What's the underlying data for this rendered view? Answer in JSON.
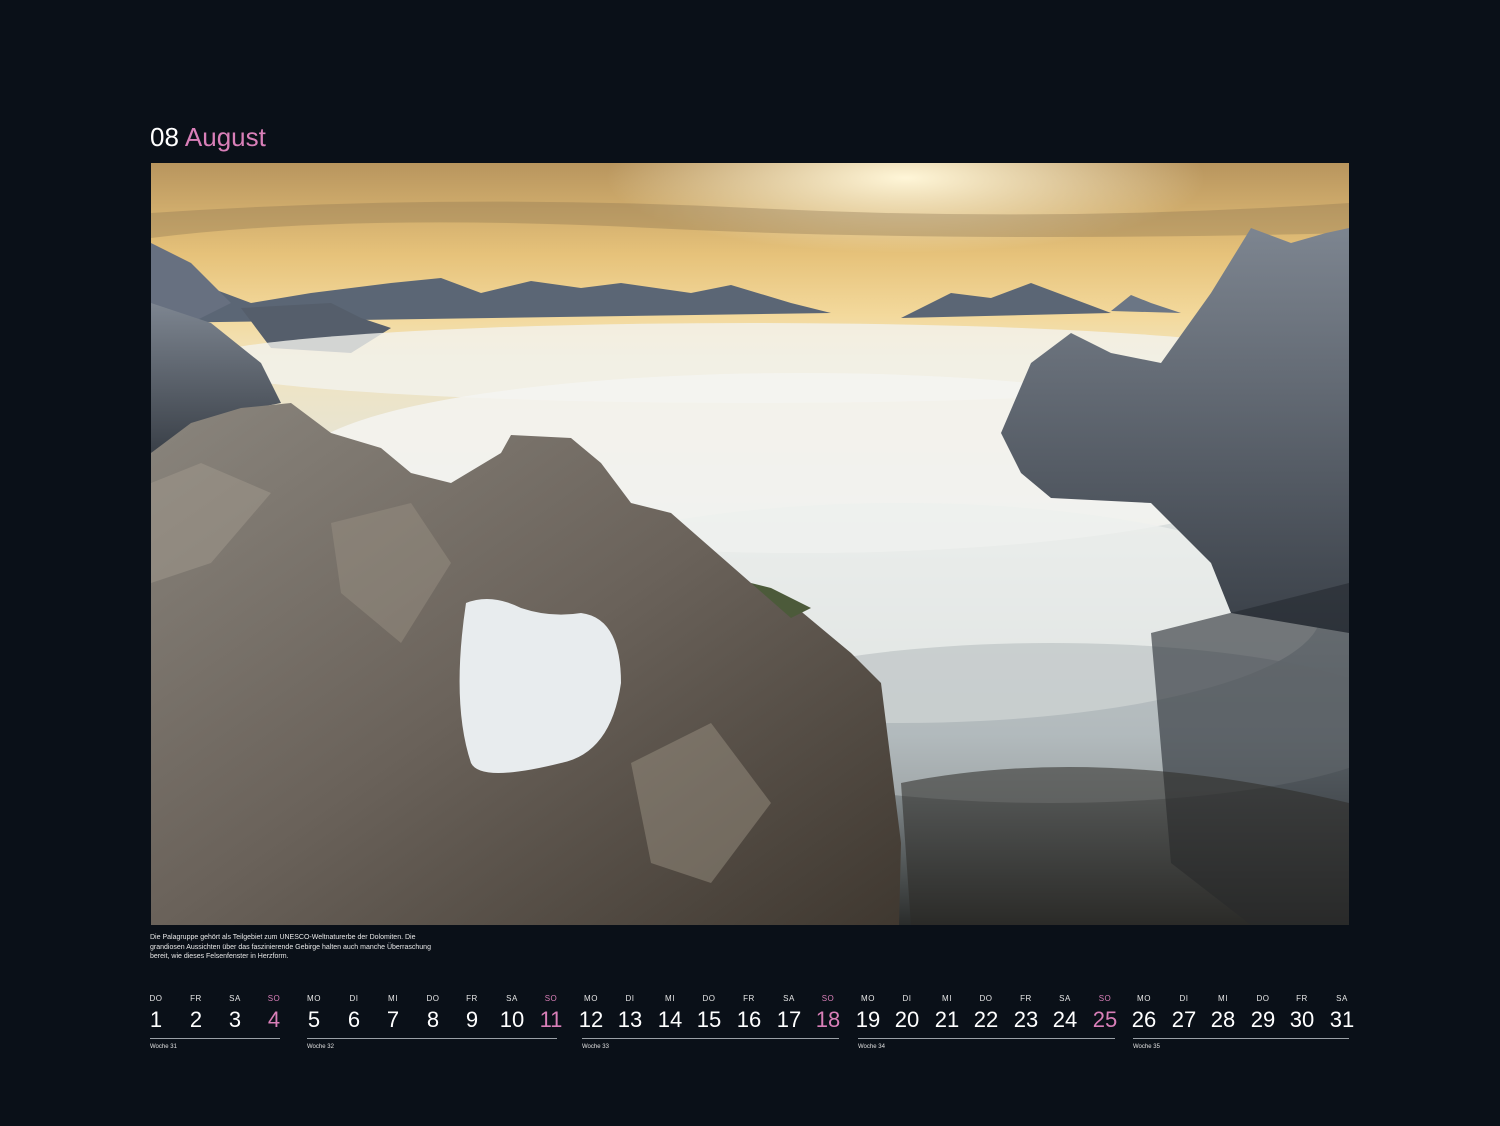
{
  "header": {
    "month_number": "08",
    "month_name": "August"
  },
  "caption": "Die Palagruppe gehört als Teilgebiet zum UNESCO-Weltnaturerbe der Dolomiten. Die grandiosen Aussichten über das faszinierende Gebirge halten auch manche Überraschung bereit, wie dieses Felsenfenster in Herzform.",
  "colors": {
    "background": "#0a1018",
    "accent": "#d97fb8",
    "text": "#ffffff"
  },
  "days": [
    {
      "dow": "DO",
      "num": "1",
      "sunday": false
    },
    {
      "dow": "FR",
      "num": "2",
      "sunday": false
    },
    {
      "dow": "SA",
      "num": "3",
      "sunday": false
    },
    {
      "dow": "SO",
      "num": "4",
      "sunday": true
    },
    {
      "dow": "MO",
      "num": "5",
      "sunday": false
    },
    {
      "dow": "DI",
      "num": "6",
      "sunday": false
    },
    {
      "dow": "MI",
      "num": "7",
      "sunday": false
    },
    {
      "dow": "DO",
      "num": "8",
      "sunday": false
    },
    {
      "dow": "FR",
      "num": "9",
      "sunday": false
    },
    {
      "dow": "SA",
      "num": "10",
      "sunday": false
    },
    {
      "dow": "SO",
      "num": "11",
      "sunday": true
    },
    {
      "dow": "MO",
      "num": "12",
      "sunday": false
    },
    {
      "dow": "DI",
      "num": "13",
      "sunday": false
    },
    {
      "dow": "MI",
      "num": "14",
      "sunday": false
    },
    {
      "dow": "DO",
      "num": "15",
      "sunday": false
    },
    {
      "dow": "FR",
      "num": "16",
      "sunday": false
    },
    {
      "dow": "SA",
      "num": "17",
      "sunday": false
    },
    {
      "dow": "SO",
      "num": "18",
      "sunday": true
    },
    {
      "dow": "MO",
      "num": "19",
      "sunday": false
    },
    {
      "dow": "DI",
      "num": "20",
      "sunday": false
    },
    {
      "dow": "MI",
      "num": "21",
      "sunday": false
    },
    {
      "dow": "DO",
      "num": "22",
      "sunday": false
    },
    {
      "dow": "FR",
      "num": "23",
      "sunday": false
    },
    {
      "dow": "SA",
      "num": "24",
      "sunday": false
    },
    {
      "dow": "SO",
      "num": "25",
      "sunday": true
    },
    {
      "dow": "MO",
      "num": "26",
      "sunday": false
    },
    {
      "dow": "DI",
      "num": "27",
      "sunday": false
    },
    {
      "dow": "MI",
      "num": "28",
      "sunday": false
    },
    {
      "dow": "DO",
      "num": "29",
      "sunday": false
    },
    {
      "dow": "FR",
      "num": "30",
      "sunday": false
    },
    {
      "dow": "SA",
      "num": "31",
      "sunday": false
    }
  ],
  "weeks": [
    {
      "label": "Woche 31"
    },
    {
      "label": "Woche 32"
    },
    {
      "label": "Woche 33"
    },
    {
      "label": "Woche 34"
    },
    {
      "label": "Woche 35"
    }
  ]
}
